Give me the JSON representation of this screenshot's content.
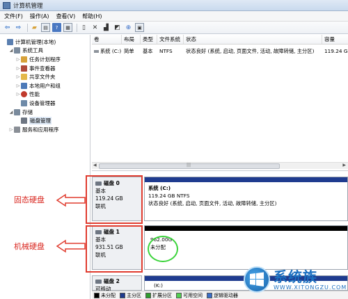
{
  "window": {
    "title": "计算机管理"
  },
  "menu": [
    "文件(F)",
    "操作(A)",
    "查看(V)",
    "帮助(H)"
  ],
  "toolbar": {
    "icons": [
      "back-arrow-icon",
      "forward-arrow-icon",
      "up-folder-icon",
      "show-hide-tree-icon",
      "help-icon",
      "view-icon",
      "properties-icon",
      "delete-icon",
      "export-icon",
      "open-icon",
      "search-icon",
      "disk-icon"
    ]
  },
  "tree": [
    {
      "label": "计算机管理(本地)",
      "level": 0,
      "expander": "",
      "color": "#5a7fb0"
    },
    {
      "label": "系统工具",
      "level": 1,
      "expander": "◢",
      "color": "#7a8a9c"
    },
    {
      "label": "任务计划程序",
      "level": 2,
      "expander": "▷",
      "color": "#d8a23a"
    },
    {
      "label": "事件查看器",
      "level": 2,
      "expander": "▷",
      "color": "#b04a3a"
    },
    {
      "label": "共享文件夹",
      "level": 2,
      "expander": "▷",
      "color": "#e4b84a"
    },
    {
      "label": "本地用户和组",
      "level": 2,
      "expander": "▷",
      "color": "#4d7ab8"
    },
    {
      "label": "性能",
      "level": 2,
      "expander": "▷",
      "color": "#c0392b"
    },
    {
      "label": "设备管理器",
      "level": 2,
      "expander": "",
      "color": "#6e8aa8"
    },
    {
      "label": "存储",
      "level": 1,
      "expander": "◢",
      "color": "#7a8a9c"
    },
    {
      "label": "磁盘管理",
      "level": 2,
      "expander": "",
      "color": "#6e7682",
      "selected": true
    },
    {
      "label": "服务和应用程序",
      "level": 1,
      "expander": "▷",
      "color": "#8a8f96"
    }
  ],
  "volume_list": {
    "headers": [
      "卷",
      "布局",
      "类型",
      "文件系统",
      "状态",
      "容量"
    ],
    "rows": [
      [
        "系统 (C:)",
        "简单",
        "基本",
        "NTFS",
        "状态良好 (系统, 启动, 页面文件, 活动, 故障转储, 主分区)",
        "119.24 GB"
      ]
    ]
  },
  "disks": [
    {
      "name": "磁盘 0",
      "type": "基本",
      "size": "119.24 GB",
      "status": "联机",
      "partition": {
        "name": "系统  (C:)",
        "detail": "119.24 GB NTFS",
        "status": "状态良好 (系统, 启动, 页面文件, 活动, 故障转储, 主分区)",
        "bar_color": "#1f3b8f"
      }
    },
    {
      "name": "磁盘 1",
      "type": "基本",
      "size": "931.51 GB",
      "status": "联机",
      "partition": {
        "name": "962.00G",
        "detail": "未分配",
        "bar_color": "#000000"
      }
    },
    {
      "name": "磁盘 2",
      "type": "可移动",
      "partition": {
        "name": "(K:)",
        "bar_color": "#1f3b8f"
      }
    }
  ],
  "legend": [
    {
      "label": "未分配",
      "color": "#000000"
    },
    {
      "label": "主分区",
      "color": "#1f3b8f"
    },
    {
      "label": "扩展分区",
      "color": "#2e9d2e"
    },
    {
      "label": "可用空间",
      "color": "#52d052"
    },
    {
      "label": "逻辑驱动器",
      "color": "#3a6fc8"
    }
  ],
  "annotations": {
    "ssd": "固态硬盘",
    "hdd": "机械硬盘"
  },
  "watermark": {
    "main": "系统族",
    "url": "WWW.XITONGZU.COM"
  }
}
